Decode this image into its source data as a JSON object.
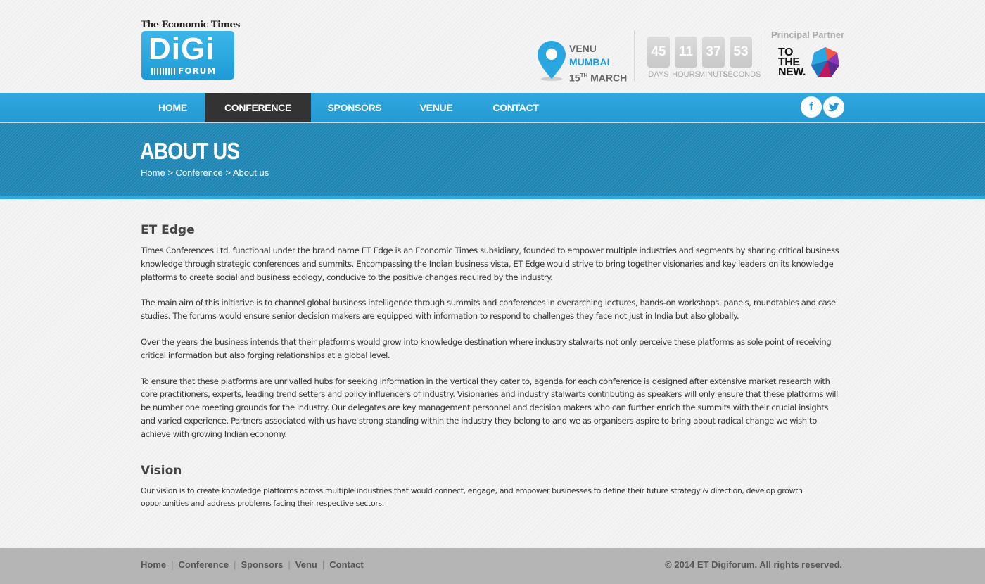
{
  "header": {
    "logo": {
      "publisher": "The Economic Times",
      "name": "DiGi",
      "sub": "FORUM"
    },
    "venue": {
      "line1": "VENU",
      "city": "MUMBAI",
      "day": "15",
      "day_suffix": "TH",
      "month": "MARCH"
    },
    "countdown": [
      {
        "value": "45",
        "label": "DAYS"
      },
      {
        "value": "11",
        "label": "HOURS"
      },
      {
        "value": "37",
        "label": "MINUTS"
      },
      {
        "value": "53",
        "label": "SECONDS"
      }
    ],
    "partner": {
      "label": "Principal Partner",
      "line1": "TO",
      "line2": "THE",
      "line3": "NEW."
    }
  },
  "nav": {
    "items": [
      {
        "label": "HOME",
        "active": false
      },
      {
        "label": "CONFERENCE",
        "active": true
      },
      {
        "label": "SPONSORS",
        "active": false
      },
      {
        "label": "VENUE",
        "active": false
      },
      {
        "label": "CONTACT",
        "active": false
      }
    ],
    "social": [
      "facebook-icon",
      "twitter-icon"
    ]
  },
  "banner": {
    "title": "ABOUT US",
    "breadcrumb": [
      "Home",
      "Conference",
      "About us"
    ],
    "separator": ">"
  },
  "content": {
    "sections": [
      {
        "heading": "ET Edge",
        "paragraphs": [
          "Times Conferences Ltd. functional under the brand name ET Edge is an Economic Times subsidiary, founded to empower multiple industries and segments by sharing critical business knowledge through strategic conferences and summits. Encompassing the Indian business vista, ET Edge would strive to bring together visionaries and key leaders on its knowledge platforms to create social and business ecology, conducive to the positive changes required by the industry.",
          "The main aim of this initiative is to channel global business intelligence through summits and conferences in overarching lectures, hands-on workshops, panels, roundtables and case studies. The forums would ensure senior decision makers are equipped with information to respond to challenges they face not just in India but also globally.",
          "Over the years the business intends that their platforms would grow into knowledge destination where industry stalwarts not only perceive these platforms as sole point of receiving critical information but also forging relationships at a global level.",
          "To ensure that these platforms are unrivalled hubs for seeking information in the vertical they cater to, agenda for each conference is designed after extensive market research with core practitioners, experts, leading trend setters and policy influencers of industry. Visionaries and industry stalwarts contributing as speakers will only ensure that these platforms will be number one meeting grounds for the industry. Our delegates are key management personnel and decision makers who can further enrich the summits with their crucial insights and varied experience. Partners associated with us have strong standing within the industry they belong to and we as organisers aspire to bring about radical change we wish to achieve with growing Indian economy."
        ]
      },
      {
        "heading": "Vision",
        "paragraphs": [
          "Our vision is to create knowledge platforms across multiple industries that would connect, engage, and empower businesses to define their future strategy & direction, develop growth opportunities and address problems facing their respective sectors."
        ]
      }
    ]
  },
  "footer": {
    "links": [
      "Home",
      "Conference",
      "Sponsors",
      "Venu",
      "Contact"
    ],
    "separator": "|",
    "copyright": "© 2014 ET Digiforum. All rights reserved."
  },
  "colors": {
    "brand_blue": "#2599d2",
    "banner_blue": "#1f86b4",
    "active_nav": "#333333",
    "footer": "#b5b5b5"
  }
}
